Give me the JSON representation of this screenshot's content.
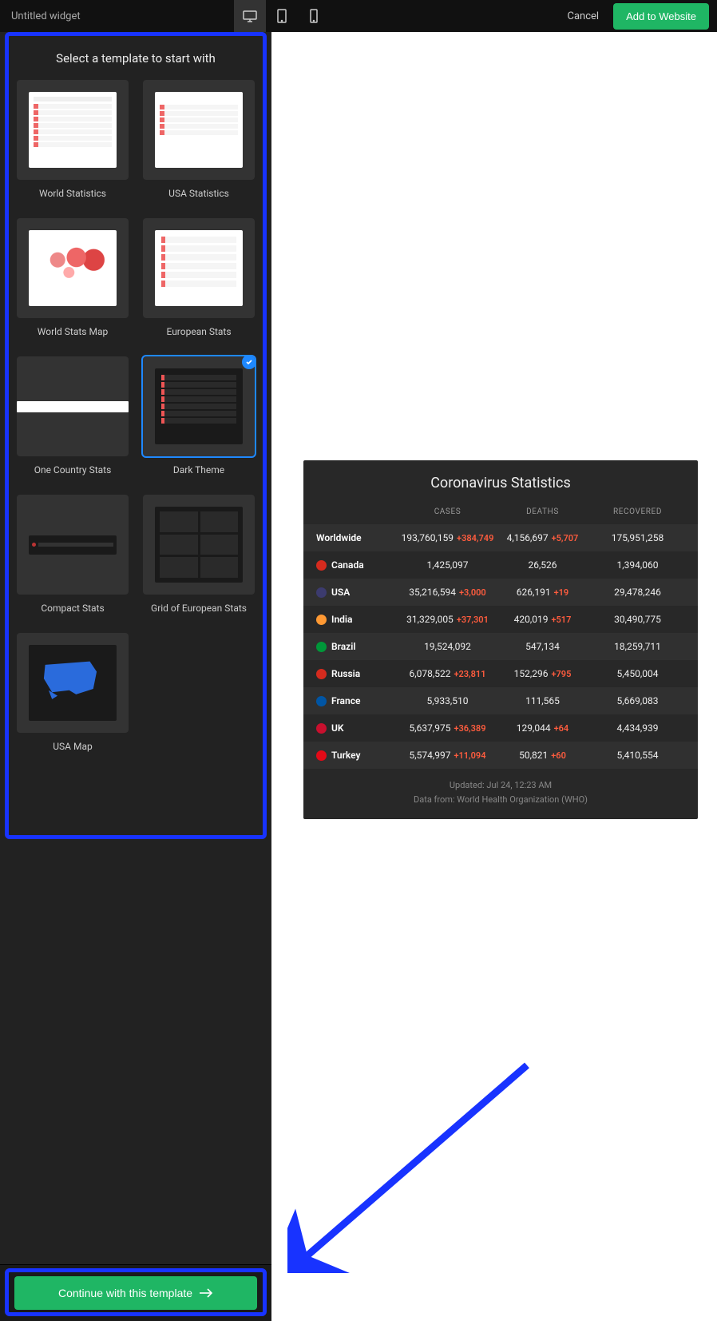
{
  "header": {
    "title": "Untitled widget",
    "cancel": "Cancel",
    "add": "Add to Website"
  },
  "panel": {
    "title": "Select a template to start with",
    "templates": [
      {
        "label": "World Statistics"
      },
      {
        "label": "USA Statistics"
      },
      {
        "label": "World Stats Map"
      },
      {
        "label": "European Stats"
      },
      {
        "label": "One Country Stats"
      },
      {
        "label": "Dark Theme",
        "selected": true
      },
      {
        "label": "Compact Stats"
      },
      {
        "label": "Grid of European Stats"
      },
      {
        "label": "USA Map"
      }
    ],
    "continue": "Continue with this template"
  },
  "preview": {
    "title": "Coronavirus Statistics",
    "columns": {
      "cases": "CASES",
      "deaths": "DEATHS",
      "recovered": "RECOVERED"
    },
    "rows": [
      {
        "name": "Worldwide",
        "flag": "",
        "cases": "193,760,159",
        "cases_delta": "+384,749",
        "deaths": "4,156,697",
        "deaths_delta": "+5,707",
        "recovered": "175,951,258"
      },
      {
        "name": "Canada",
        "flag": "#d52b1e",
        "cases": "1,425,097",
        "cases_delta": "",
        "deaths": "26,526",
        "deaths_delta": "",
        "recovered": "1,394,060"
      },
      {
        "name": "USA",
        "flag": "#3c3b6e",
        "cases": "35,216,594",
        "cases_delta": "+3,000",
        "deaths": "626,191",
        "deaths_delta": "+19",
        "recovered": "29,478,246"
      },
      {
        "name": "India",
        "flag": "#ff9933",
        "cases": "31,329,005",
        "cases_delta": "+37,301",
        "deaths": "420,019",
        "deaths_delta": "+517",
        "recovered": "30,490,775"
      },
      {
        "name": "Brazil",
        "flag": "#009739",
        "cases": "19,524,092",
        "cases_delta": "",
        "deaths": "547,134",
        "deaths_delta": "",
        "recovered": "18,259,711"
      },
      {
        "name": "Russia",
        "flag": "#d52b1e",
        "cases": "6,078,522",
        "cases_delta": "+23,811",
        "deaths": "152,296",
        "deaths_delta": "+795",
        "recovered": "5,450,004"
      },
      {
        "name": "France",
        "flag": "#0055a4",
        "cases": "5,933,510",
        "cases_delta": "",
        "deaths": "111,565",
        "deaths_delta": "",
        "recovered": "5,669,083"
      },
      {
        "name": "UK",
        "flag": "#c8102e",
        "cases": "5,637,975",
        "cases_delta": "+36,389",
        "deaths": "129,044",
        "deaths_delta": "+64",
        "recovered": "4,434,939"
      },
      {
        "name": "Turkey",
        "flag": "#e30a17",
        "cases": "5,574,997",
        "cases_delta": "+11,094",
        "deaths": "50,821",
        "deaths_delta": "+60",
        "recovered": "5,410,554"
      }
    ],
    "footer1": "Updated: Jul 24, 12:23 AM",
    "footer2": "Data from: World Health Organization (WHO)"
  }
}
